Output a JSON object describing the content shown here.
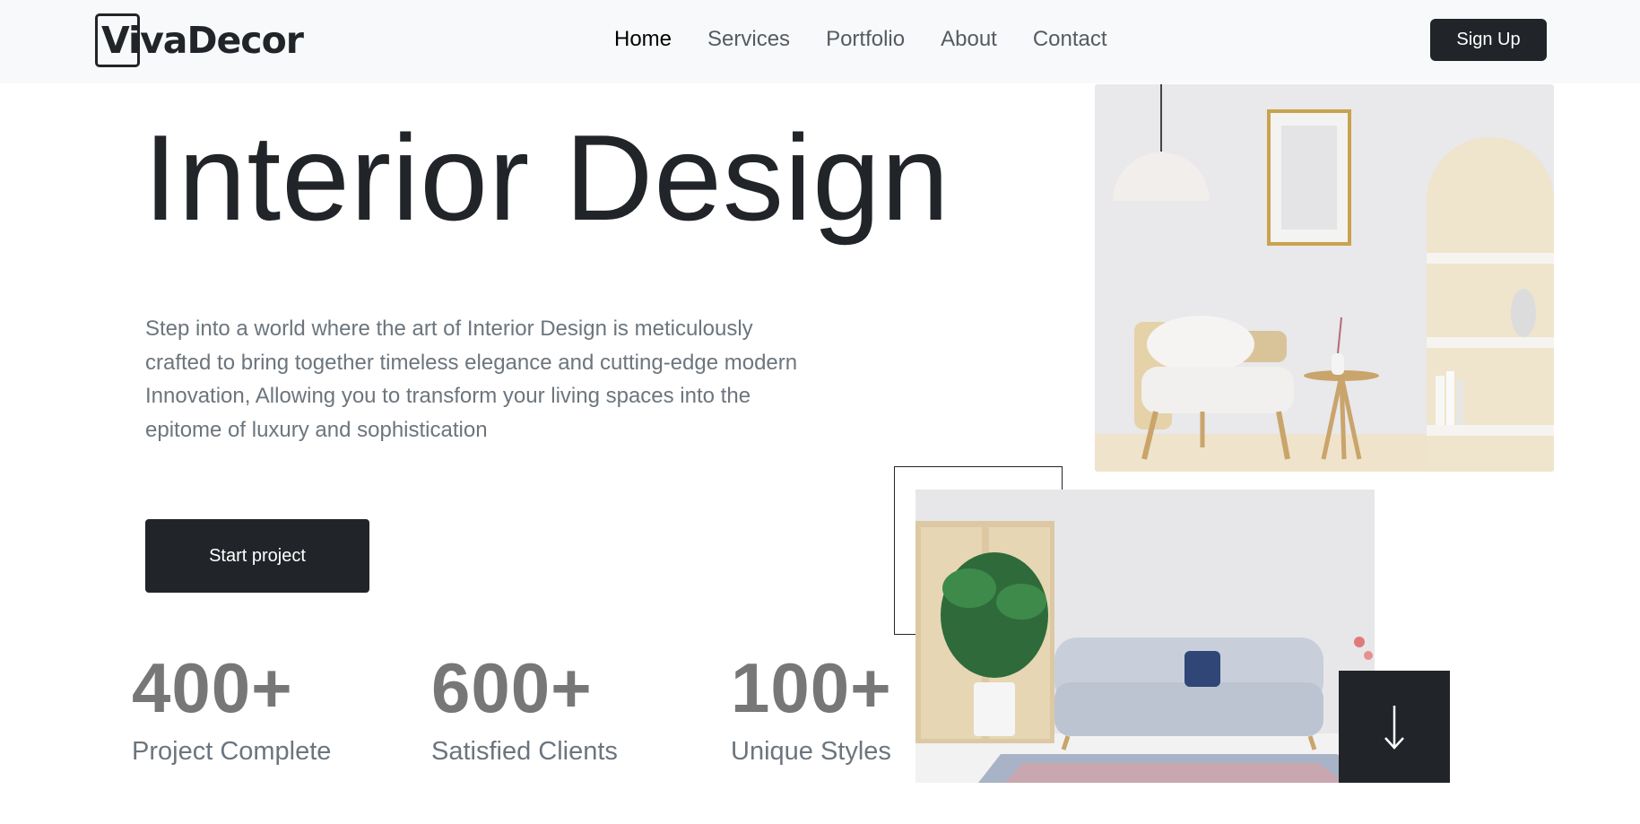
{
  "header": {
    "logo": "VivaDecor",
    "nav": [
      "Home",
      "Services",
      "Portfolio",
      "About",
      "Contact"
    ],
    "active_nav": "Home",
    "signup_label": "Sign Up"
  },
  "hero": {
    "title": "Interior Design",
    "description": "Step into a world where the art of Interior Design is meticulously crafted to bring together timeless elegance and cutting-edge modern Innovation, Allowing you to transform your living spaces into the epitome of luxury and sophistication",
    "cta_label": "Start project"
  },
  "stats": [
    {
      "value": "400+",
      "label": "Project Complete"
    },
    {
      "value": "600+",
      "label": "Satisfied Clients"
    },
    {
      "value": "100+",
      "label": "Unique Styles"
    }
  ],
  "icons": {
    "scroll": "arrow-down-icon"
  },
  "colors": {
    "primary": "#212529",
    "header_bg": "#f8f9fa",
    "muted_text": "#6c757d"
  }
}
